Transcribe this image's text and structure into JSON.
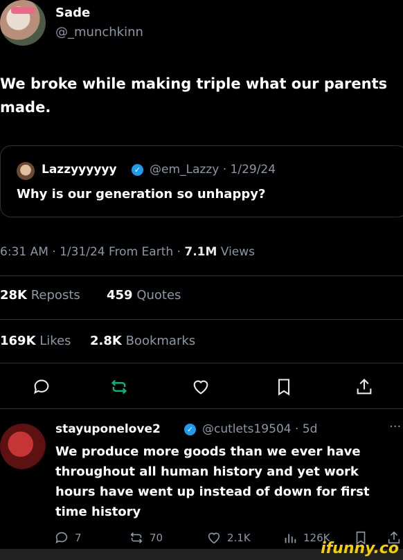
{
  "tweet": {
    "author_name": "Sade",
    "author_handle": "@_munchkinn",
    "text": "We broke while making triple what our parents made.",
    "quote": {
      "author_name": "Lazzyyyyyy",
      "author_handle": "@em_Lazzy · 1/29/24",
      "text": "Why is our generation so unhappy?"
    },
    "meta": {
      "time_date": "6:31 AM · 1/31/24 From Earth · ",
      "views_count": "7.1M",
      "views_label": " Views"
    },
    "stats": {
      "reposts_count": "28K",
      "reposts_label": "Reposts",
      "quotes_count": "459",
      "quotes_label": "Quotes",
      "likes_count": "169K",
      "likes_label": "Likes",
      "bookmarks_count": "2.8K",
      "bookmarks_label": "Bookmarks"
    }
  },
  "reply": {
    "author_name": "stayuponelove2",
    "author_handle": "@cutlets19504 · 5d",
    "more": "···",
    "text": "We produce more goods than we ever have throughout all human history and yet work hours have went up instead of down for first time history",
    "actions": {
      "replies": "7",
      "reposts": "70",
      "likes": "2.1K",
      "views": "126K"
    }
  },
  "watermark": "ifunny.co",
  "colors": {
    "background": "#000000",
    "text_primary": "#e7e9ea",
    "text_secondary": "#8b98a5",
    "verified_blue": "#1d9bf0",
    "repost_green": "#00ba7c",
    "divider": "#2f3336",
    "watermark_yellow": "#f5d000"
  }
}
